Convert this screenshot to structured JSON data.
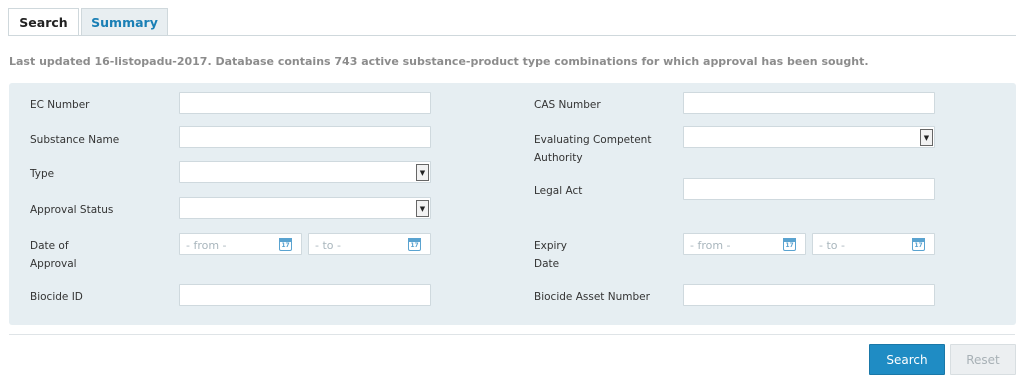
{
  "tabs": [
    {
      "label": "Search",
      "active": true
    },
    {
      "label": "Summary",
      "active": false
    }
  ],
  "info": {
    "text": "Last updated 16-listopadu-2017. Database contains 743 active substance-product type combinations for which approval has been sought."
  },
  "form": {
    "ec_number": {
      "label": "EC Number",
      "value": ""
    },
    "cas_number": {
      "label": "CAS Number",
      "value": ""
    },
    "substance_name": {
      "label": "Substance Name",
      "value": ""
    },
    "evaluating_authority": {
      "label_line1": "Evaluating Competent",
      "label_line2": "Authority",
      "value": ""
    },
    "type": {
      "label": "Type",
      "value": ""
    },
    "legal_act": {
      "label": "Legal Act",
      "value": ""
    },
    "approval_status": {
      "label": "Approval Status",
      "value": ""
    },
    "date_of_approval": {
      "label_line1": "Date of",
      "label_line2": "Approval",
      "from_placeholder": "- from -",
      "to_placeholder": "- to -"
    },
    "expiry_date": {
      "label_line1": "Expiry",
      "label_line2": "Date",
      "from_placeholder": "- from -",
      "to_placeholder": "- to -"
    },
    "biocide_id": {
      "label": "Biocide ID",
      "value": ""
    },
    "biocide_asset_number": {
      "label": "Biocide Asset Number",
      "value": ""
    },
    "calendar_day": "17"
  },
  "buttons": {
    "search": "Search",
    "reset": "Reset"
  },
  "colors": {
    "accent": "#1f8cc4",
    "panel_bg": "#e6eef2",
    "tab_link": "#1a7fb5"
  },
  "icons": {
    "calendar": "calendar-icon",
    "dropdown": "chevron-down-icon"
  }
}
